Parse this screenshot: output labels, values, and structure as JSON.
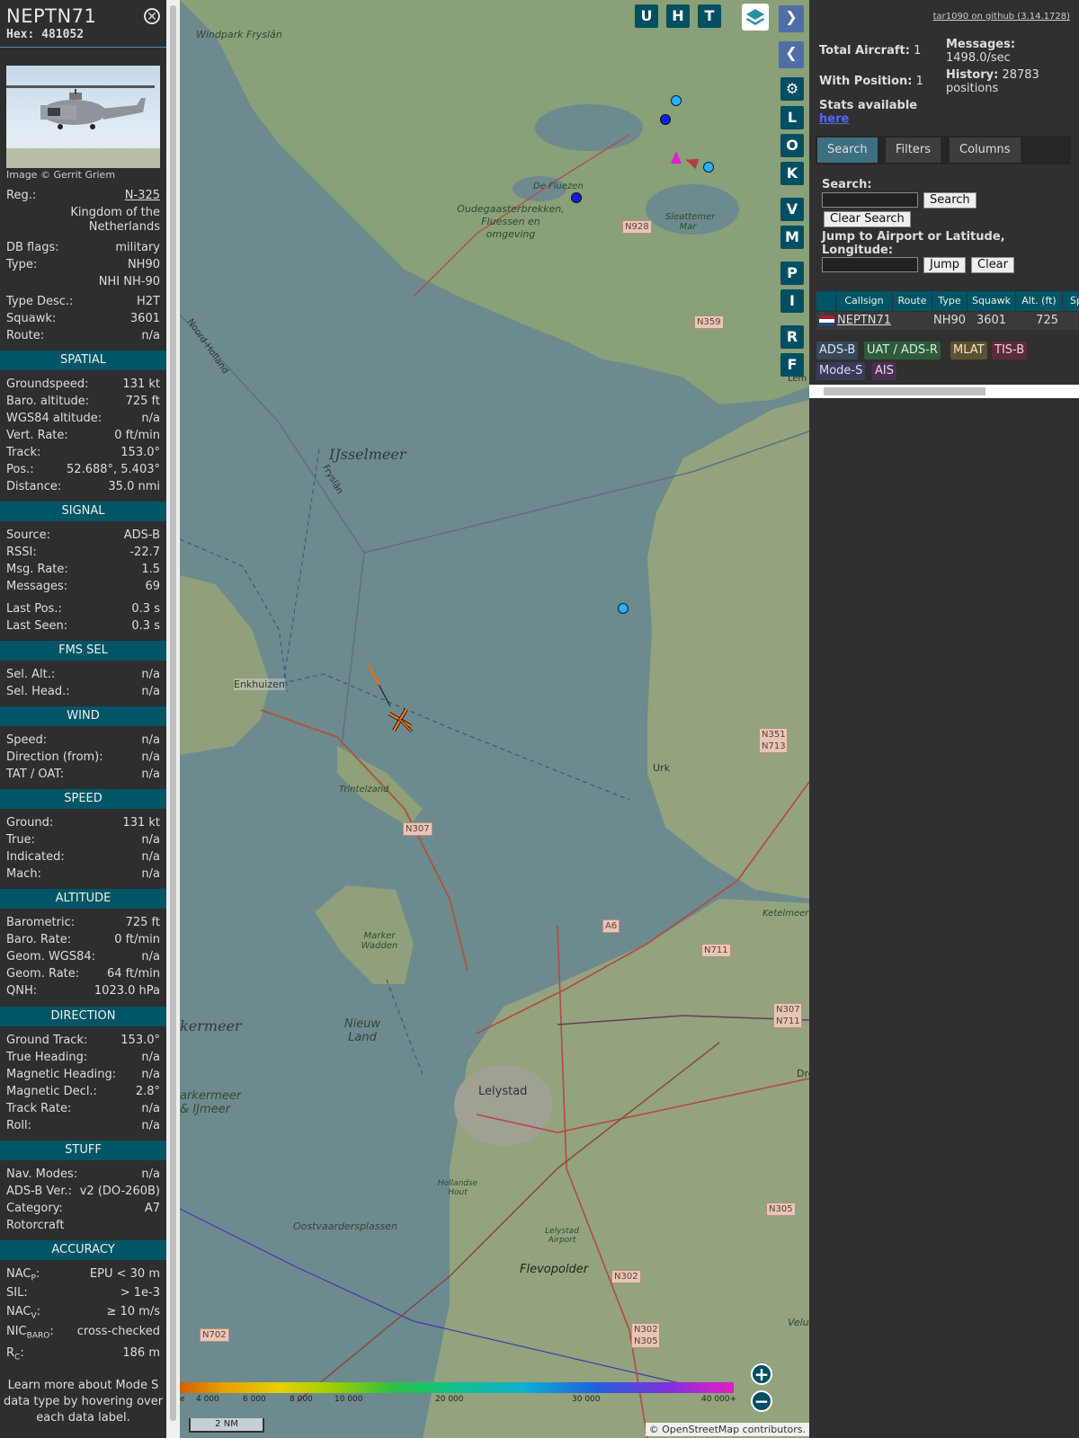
{
  "aircraft": {
    "callsign": "NEPTN71",
    "hex_label": "Hex:",
    "hex": "481052",
    "photo_credit": "Image © Gerrit Griem"
  },
  "info_rows": [
    {
      "key": "Reg.:",
      "value": "N-325"
    },
    {
      "key": "",
      "value": "Kingdom of the Netherlands"
    },
    {
      "key": "DB flags:",
      "value": "military"
    },
    {
      "key": "Type:",
      "value": "NH90"
    },
    {
      "key": "",
      "value": "NHI NH-90"
    },
    {
      "key": "Type Desc.:",
      "value": "H2T"
    },
    {
      "key": "Squawk:",
      "value": "3601"
    },
    {
      "key": "Route:",
      "value": "n/a"
    }
  ],
  "sections": {
    "spatial": {
      "title": "SPATIAL",
      "rows": [
        {
          "key": "Groundspeed:",
          "value": "131 kt"
        },
        {
          "key": "Baro. altitude:",
          "value": "725 ft"
        },
        {
          "key": "WGS84 altitude:",
          "value": "n/a"
        },
        {
          "key": "Vert. Rate:",
          "value": "0 ft/min"
        },
        {
          "key": "Track:",
          "value": "153.0°"
        },
        {
          "key": "Pos.:",
          "value": "52.688°, 5.403°"
        },
        {
          "key": "Distance:",
          "value": "35.0 nmi"
        }
      ]
    },
    "signal": {
      "title": "SIGNAL",
      "rows": [
        {
          "key": "Source:",
          "value": "ADS-B"
        },
        {
          "key": "RSSI:",
          "value": "-22.7"
        },
        {
          "key": "Msg. Rate:",
          "value": "1.5"
        },
        {
          "key": "Messages:",
          "value": "69"
        },
        {
          "key": "Last Pos.:",
          "value": "0.3 s"
        },
        {
          "key": "Last Seen:",
          "value": "0.3 s"
        }
      ]
    },
    "fms": {
      "title": "FMS SEL",
      "rows": [
        {
          "key": "Sel. Alt.:",
          "value": "n/a"
        },
        {
          "key": "Sel. Head.:",
          "value": "n/a"
        }
      ]
    },
    "wind": {
      "title": "WIND",
      "rows": [
        {
          "key": "Speed:",
          "value": "n/a"
        },
        {
          "key": "Direction (from):",
          "value": "n/a"
        },
        {
          "key": "TAT / OAT:",
          "value": "n/a"
        }
      ]
    },
    "speed": {
      "title": "SPEED",
      "rows": [
        {
          "key": "Ground:",
          "value": "131 kt"
        },
        {
          "key": "True:",
          "value": "n/a"
        },
        {
          "key": "Indicated:",
          "value": "n/a"
        },
        {
          "key": "Mach:",
          "value": "n/a"
        }
      ]
    },
    "altitude": {
      "title": "ALTITUDE",
      "rows": [
        {
          "key": "Barometric:",
          "value": "725 ft"
        },
        {
          "key": "Baro. Rate:",
          "value": "0 ft/min"
        },
        {
          "key": "Geom. WGS84:",
          "value": "n/a"
        },
        {
          "key": "Geom. Rate:",
          "value": "64 ft/min"
        },
        {
          "key": "QNH:",
          "value": "1023.0 hPa"
        }
      ]
    },
    "direction": {
      "title": "DIRECTION",
      "rows": [
        {
          "key": "Ground Track:",
          "value": "153.0°"
        },
        {
          "key": "True Heading:",
          "value": "n/a"
        },
        {
          "key": "Magnetic Heading:",
          "value": "n/a"
        },
        {
          "key": "Magnetic Decl.:",
          "value": "2.8°"
        },
        {
          "key": "Track Rate:",
          "value": "n/a"
        },
        {
          "key": "Roll:",
          "value": "n/a"
        }
      ]
    },
    "stuff": {
      "title": "STUFF",
      "rows": [
        {
          "key": "Nav. Modes:",
          "value": "n/a"
        },
        {
          "key": "ADS-B Ver.:",
          "value": "v2 (DO-260B)"
        },
        {
          "key": "Category:",
          "value": "A7"
        },
        {
          "key": "Rotorcraft",
          "value": ""
        }
      ]
    },
    "accuracy": {
      "title": "ACCURACY",
      "rows": [
        {
          "key": "NAC",
          "sub": "P",
          "value": "EPU < 30 m"
        },
        {
          "key": "SIL:",
          "sub": "",
          "value": "> 1e-3"
        },
        {
          "key": "NAC",
          "sub": "V",
          "value": "≥ 10 m/s"
        },
        {
          "key": "NIC",
          "sub": "BARO",
          "value": "cross-checked"
        },
        {
          "key": "R",
          "sub": "C",
          "value": "186 m"
        }
      ]
    }
  },
  "learn_more": "Learn more about Mode S data type by hovering over each data label.",
  "map": {
    "buttons_top": [
      "U",
      "H",
      "T"
    ],
    "buttons_side": [
      "L",
      "O",
      "K",
      "V",
      "M",
      "P",
      "I",
      "R",
      "F"
    ],
    "labels": {
      "windpark": "Windpark Fryslân",
      "de_fluezen": "De Fluezen",
      "oudegaaster": "Oudegaasterbrekken, Fluessen en omgeving",
      "sleattemer": "Sleattemer Mar",
      "ijsselmeer": "IJsselmeer",
      "fryslan": "Fryslân",
      "noord_holland": "Noord-Holland",
      "enkhuizen": "Enkhuizen",
      "trintelzand": "Trintelzand",
      "urk": "Urk",
      "marker_wadden": "Marker Wadden",
      "nieuw_land": "Nieuw Land",
      "markermeer": "kermeer",
      "markermeer_ijmeer": "arkermeer & IJmeer",
      "lelystad": "Lelystad",
      "hollandse_hout": "Hollandse Hout",
      "oostvaarders": "Oostvaardersplassen",
      "lelystad_airport": "Lelystad Airport",
      "flevopolder": "Flevopolder",
      "ketelmeer": "Ketelmeer",
      "lem": "Lem",
      "dro": "Dro",
      "velu": "Velu"
    },
    "roads": [
      "N928",
      "N359",
      "N307",
      "A6",
      "N711",
      "N351 N713",
      "N307 N711",
      "N305",
      "N302",
      "N302 N305",
      "N702"
    ],
    "alt_ticks": [
      "e",
      "4 000",
      "6 000",
      "8 000",
      "10 000",
      "20 000",
      "30 000",
      "40 000+"
    ],
    "scale": "2 NM",
    "attribution": "© OpenStreetMap contributors."
  },
  "panel": {
    "github": "tar1090 on github (3.14.1728)",
    "total_label": "Total Aircraft:",
    "total": "1",
    "messages_label": "Messages:",
    "messages": "1498.0/sec",
    "withpos_label": "With Position:",
    "withpos": "1",
    "history_label": "History:",
    "history": "28783 positions",
    "stats_text": "Stats available",
    "stats_link": "here",
    "tabs": [
      "Search",
      "Filters",
      "Columns"
    ],
    "search_label": "Search:",
    "search_value": "",
    "search_btn": "Search",
    "clear_search_btn": "Clear Search",
    "jump_label": "Jump to Airport or Latitude, Longitude:",
    "jump_value": "",
    "jump_btn": "Jump",
    "clear_btn": "Clear",
    "table": {
      "headers": [
        "Callsign",
        "Route",
        "Type",
        "Squawk",
        "Alt. (ft)",
        "Sp"
      ],
      "row": {
        "callsign": "NEPTN71",
        "route": "",
        "type": "NH90",
        "squawk": "3601",
        "alt": "725"
      }
    },
    "badges": [
      {
        "label": "ADS-B",
        "bg": "#36485a",
        "fg": "#d6e4ef"
      },
      {
        "label": "UAT / ADS-R",
        "bg": "#2f5a3b",
        "fg": "#d4ecd8"
      },
      {
        "label": "MLAT",
        "bg": "#5c5231",
        "fg": "#efe6c8"
      },
      {
        "label": "TIS-B",
        "bg": "#5b2a3c",
        "fg": "#f2d0dc"
      },
      {
        "label": "Mode-S",
        "bg": "#3a3a58",
        "fg": "#dcdcf2"
      },
      {
        "label": "AIS",
        "bg": "#4a3050",
        "fg": "#ecd6f0"
      }
    ]
  }
}
